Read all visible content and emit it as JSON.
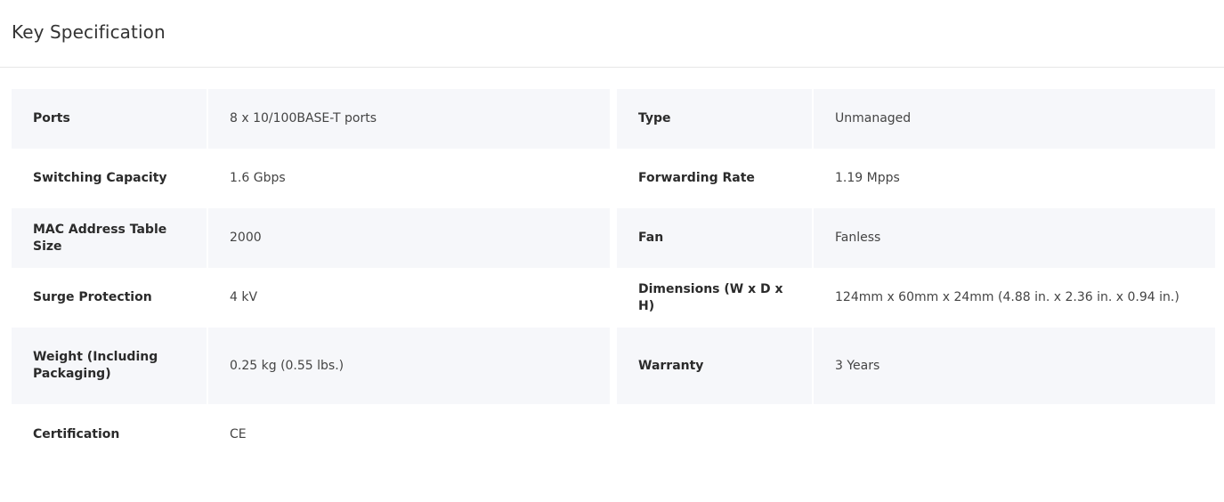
{
  "header": {
    "title": "Key Specification"
  },
  "specs": [
    {
      "left": {
        "label": "Ports",
        "value": "8 x 10/100BASE-T ports"
      },
      "right": {
        "label": "Type",
        "value": "Unmanaged"
      }
    },
    {
      "left": {
        "label": "Switching Capacity",
        "value": "1.6 Gbps"
      },
      "right": {
        "label": "Forwarding Rate",
        "value": "1.19 Mpps"
      }
    },
    {
      "left": {
        "label": "MAC Address Table Size",
        "value": "2000"
      },
      "right": {
        "label": "Fan",
        "value": "Fanless"
      }
    },
    {
      "left": {
        "label": "Surge Protection",
        "value": "4 kV"
      },
      "right": {
        "label": "Dimensions (W x D x H)",
        "value": "124mm x 60mm x 24mm (4.88 in. x 2.36 in. x 0.94 in.)"
      }
    },
    {
      "left": {
        "label": "Weight (Including Packaging)",
        "value": "0.25 kg (0.55 lbs.)"
      },
      "right": {
        "label": "Warranty",
        "value": "3 Years"
      }
    },
    {
      "left": {
        "label": "Certification",
        "value": "CE"
      }
    }
  ],
  "colors": {
    "row_shade": "#f6f7fa",
    "divider": "#e6e6e6"
  }
}
